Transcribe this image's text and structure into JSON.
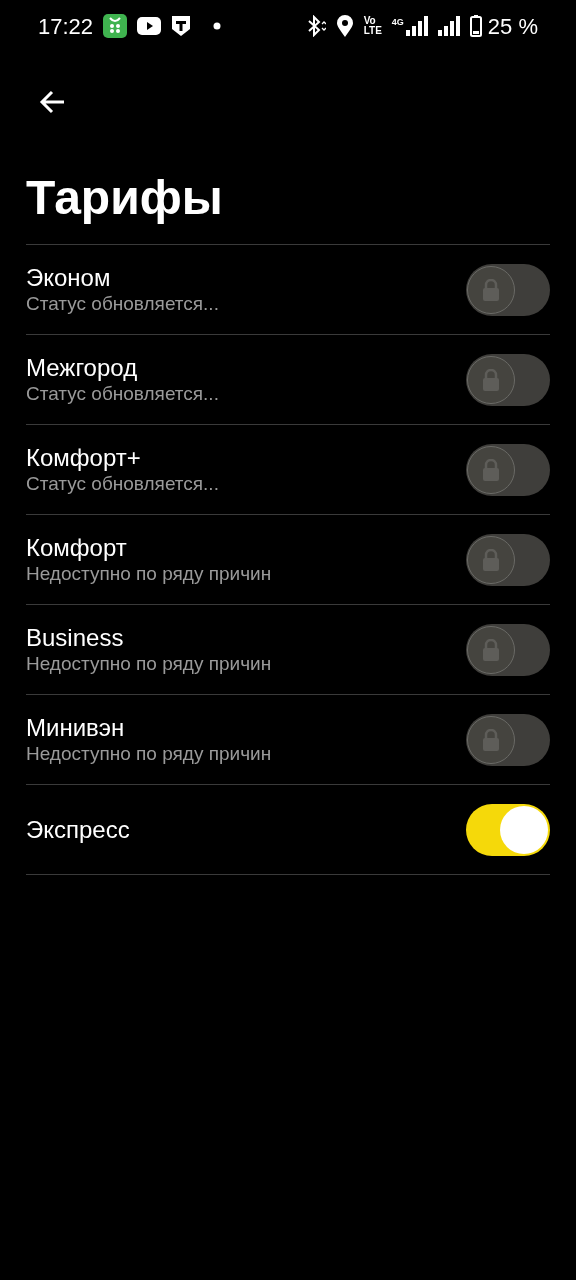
{
  "status_bar": {
    "time": "17:22",
    "volte_top": "Vo",
    "volte_bottom": "LTE",
    "network": "4G",
    "battery": "25 %"
  },
  "title": "Тарифы",
  "tariffs": [
    {
      "name": "Эконом",
      "status": "Статус обновляется...",
      "on": false,
      "locked": true
    },
    {
      "name": "Межгород",
      "status": "Статус обновляется...",
      "on": false,
      "locked": true
    },
    {
      "name": "Комфорт+",
      "status": "Статус обновляется...",
      "on": false,
      "locked": true
    },
    {
      "name": "Комфорт",
      "status": "Недоступно по ряду причин",
      "on": false,
      "locked": true
    },
    {
      "name": "Business",
      "status": "Недоступно по ряду причин",
      "on": false,
      "locked": true
    },
    {
      "name": "Минивэн",
      "status": "Недоступно по ряду причин",
      "on": false,
      "locked": true
    },
    {
      "name": "Экспресс",
      "on": true,
      "locked": false
    }
  ]
}
